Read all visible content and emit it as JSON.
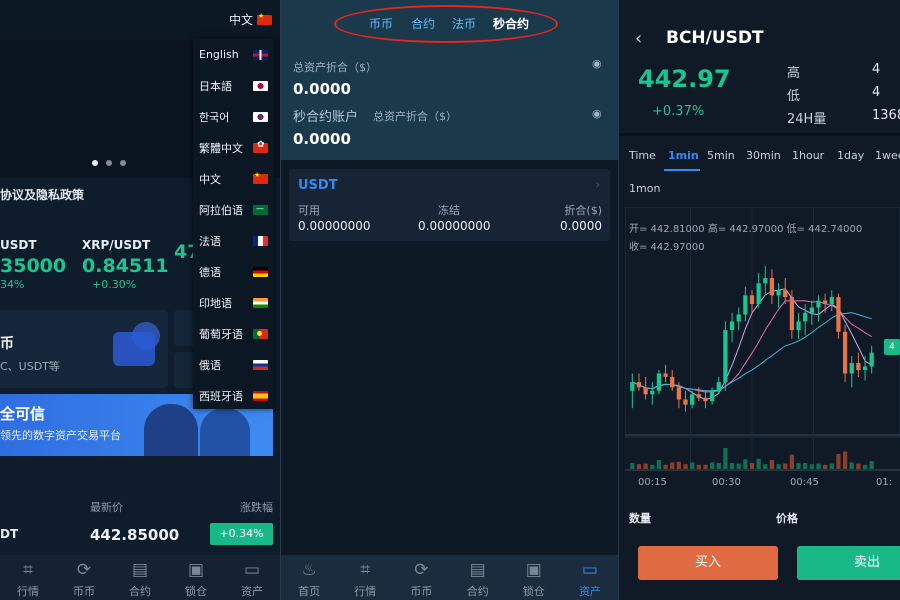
{
  "panel1": {
    "current_lang": "中文",
    "languages": [
      "English",
      "日本語",
      "한국어",
      "繁體中文",
      "中文",
      "阿拉伯语",
      "法语",
      "德语",
      "印地语",
      "葡萄牙语",
      "俄语",
      "西班牙语"
    ],
    "notice": "协议及隐私政策",
    "tickers": [
      {
        "pair": "USDT",
        "price": "35000",
        "change": "34%"
      },
      {
        "pair": "XRP/USDT",
        "price": "0.84511",
        "change": "+0.30%"
      },
      {
        "pair": "",
        "price": "47",
        "change": ""
      }
    ],
    "card": {
      "title": "币",
      "subtitle": "C、USDT等"
    },
    "hero": {
      "title": "全可信",
      "subtitle": "领先的数字资产交易平台"
    },
    "market_head": {
      "price": "最新价",
      "change": "涨跌幅"
    },
    "market_row": {
      "symbol": "DT",
      "price": "442.85000",
      "change": "+0.34%"
    },
    "nav": [
      {
        "icon": "⌗",
        "label": "行情"
      },
      {
        "icon": "⟳",
        "label": "币币"
      },
      {
        "icon": "▤",
        "label": "合约"
      },
      {
        "icon": "▣",
        "label": "锁仓"
      },
      {
        "icon": "▭",
        "label": "资产"
      }
    ]
  },
  "panel2": {
    "tabs": [
      "币币",
      "合约",
      "法币",
      "秒合约"
    ],
    "total_label": "总资产折合（$）",
    "total_value": "0.0000",
    "second_label": "秒合约账户",
    "second_sub": "总资产折合（$）",
    "second_value": "0.0000",
    "card": {
      "title": "USDT",
      "cols": [
        {
          "label": "可用",
          "value": "0.00000000"
        },
        {
          "label": "冻结",
          "value": "0.00000000"
        },
        {
          "label": "折合($)",
          "value": "0.0000"
        }
      ]
    },
    "nav": [
      {
        "icon": "♨",
        "label": "首页"
      },
      {
        "icon": "⌗",
        "label": "行情"
      },
      {
        "icon": "⟳",
        "label": "币币"
      },
      {
        "icon": "▤",
        "label": "合约"
      },
      {
        "icon": "▣",
        "label": "锁仓"
      },
      {
        "icon": "▭",
        "label": "资产"
      }
    ],
    "active_nav": 5
  },
  "panel3": {
    "title": "BCH/USDT",
    "price": "442.97",
    "change": "+0.37%",
    "stats": [
      {
        "label": "高",
        "value": "4"
      },
      {
        "label": "低",
        "value": "4"
      },
      {
        "label": "24H量",
        "value": "1368"
      }
    ],
    "intervals": [
      "Time",
      "1min",
      "5min",
      "30min",
      "1hour",
      "1day",
      "1wee",
      "1mon"
    ],
    "active_interval": 1,
    "ohlc_line1": "开= 442.81000  高= 442.97000  低= 442.74000",
    "ohlc_line2": "收= 442.97000",
    "price_tag": "4",
    "time_labels": [
      "00:15",
      "00:30",
      "00:45",
      "01:"
    ],
    "bottom_labels": {
      "qty": "数量",
      "price": "价格"
    },
    "buy": "买入",
    "sell": "卖出"
  },
  "chart_data": {
    "type": "candlestick",
    "title": "",
    "x": [
      "00:15",
      "00:30",
      "00:45",
      "01:"
    ],
    "candles_ohlc": [
      [
        442.5,
        442.6,
        442.4,
        442.55
      ],
      [
        442.55,
        442.6,
        442.5,
        442.52
      ],
      [
        442.52,
        442.58,
        442.45,
        442.48
      ],
      [
        442.48,
        442.55,
        442.42,
        442.5
      ],
      [
        442.5,
        442.62,
        442.48,
        442.6
      ],
      [
        442.6,
        442.65,
        442.55,
        442.58
      ],
      [
        442.58,
        442.62,
        442.5,
        442.52
      ],
      [
        442.52,
        442.55,
        442.4,
        442.45
      ],
      [
        442.45,
        442.5,
        442.38,
        442.42
      ],
      [
        442.42,
        442.5,
        442.4,
        442.48
      ],
      [
        442.48,
        442.52,
        442.44,
        442.46
      ],
      [
        442.46,
        442.5,
        442.4,
        442.44
      ],
      [
        442.44,
        442.52,
        442.42,
        442.5
      ],
      [
        442.5,
        442.58,
        442.48,
        442.55
      ],
      [
        442.55,
        442.9,
        442.5,
        442.85
      ],
      [
        442.85,
        442.95,
        442.78,
        442.9
      ],
      [
        442.9,
        442.98,
        442.85,
        442.94
      ],
      [
        442.94,
        443.1,
        442.9,
        443.05
      ],
      [
        443.05,
        443.08,
        442.95,
        443.0
      ],
      [
        443.0,
        443.18,
        442.98,
        443.12
      ],
      [
        443.12,
        443.22,
        443.05,
        443.15
      ],
      [
        443.15,
        443.2,
        443.0,
        443.05
      ],
      [
        443.05,
        443.12,
        442.98,
        443.08
      ],
      [
        443.08,
        443.15,
        443.0,
        443.04
      ],
      [
        443.04,
        443.08,
        442.8,
        442.85
      ],
      [
        442.85,
        442.95,
        442.8,
        442.9
      ],
      [
        442.9,
        443.0,
        442.82,
        442.95
      ],
      [
        442.95,
        443.02,
        442.88,
        442.98
      ],
      [
        442.98,
        443.05,
        442.9,
        443.02
      ],
      [
        443.02,
        443.06,
        442.95,
        443.0
      ],
      [
        443.0,
        443.08,
        442.96,
        443.04
      ],
      [
        443.04,
        443.06,
        442.8,
        442.84
      ],
      [
        442.84,
        442.88,
        442.55,
        442.6
      ],
      [
        442.6,
        442.7,
        442.52,
        442.66
      ],
      [
        442.66,
        442.72,
        442.58,
        442.62
      ],
      [
        442.62,
        442.7,
        442.56,
        442.64
      ],
      [
        442.64,
        442.76,
        442.6,
        442.72
      ]
    ],
    "volume_visible": true
  }
}
